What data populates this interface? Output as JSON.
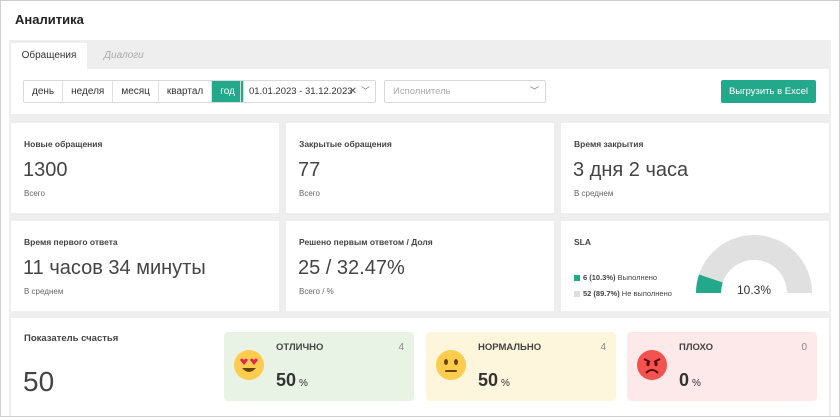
{
  "page": {
    "title": "Аналитика"
  },
  "tabs": [
    {
      "label": "Обращения",
      "active": true
    },
    {
      "label": "Диалоги",
      "active": false
    }
  ],
  "toolbar": {
    "periods": [
      "день",
      "неделя",
      "месяц",
      "квартал",
      "год"
    ],
    "active_period": "год",
    "date_range": "01.01.2023 - 31.12.2023",
    "executor_placeholder": "Исполнитель",
    "export_label": "Выгрузить в Excel"
  },
  "cards": {
    "new": {
      "label": "Новые обращения",
      "value": "1300",
      "sub": "Всего"
    },
    "closed": {
      "label": "Закрытые обращения",
      "value": "77",
      "sub": "Всего"
    },
    "close_time": {
      "label": "Время закрытия",
      "value": "3 дня 2 часа",
      "sub": "В среднем"
    },
    "first_response": {
      "label": "Время первого ответа",
      "value": "11 часов 34 минуты",
      "sub": "В среднем"
    },
    "first_solved": {
      "label": "Решено первым ответом / Доля",
      "value": "25 / 32.47%",
      "sub": "Всего / %"
    }
  },
  "sla": {
    "label": "SLA",
    "done": {
      "value": "6 (10.3%)",
      "text": "Выполнено",
      "color": "#22a88a"
    },
    "not_done": {
      "value": "52 (89.7%)",
      "text": "Не выполнено",
      "color": "#dddddd"
    },
    "gauge_fraction": 0.103,
    "gauge_text": "10.3%"
  },
  "happiness": {
    "label": "Показатель счастья",
    "value": "50",
    "moods": [
      {
        "name": "ОТЛИЧНО",
        "count": "4",
        "percent": "50",
        "unit": "%",
        "bg": "#e8f3e6",
        "icon": "heart-eyes-emoji-icon"
      },
      {
        "name": "НОРМАЛЬНО",
        "count": "4",
        "percent": "50",
        "unit": "%",
        "bg": "#fdf5dc",
        "icon": "neutral-face-emoji-icon"
      },
      {
        "name": "ПЛОХО",
        "count": "0",
        "percent": "0",
        "unit": "%",
        "bg": "#fde9e9",
        "icon": "angry-face-emoji-icon"
      }
    ]
  }
}
